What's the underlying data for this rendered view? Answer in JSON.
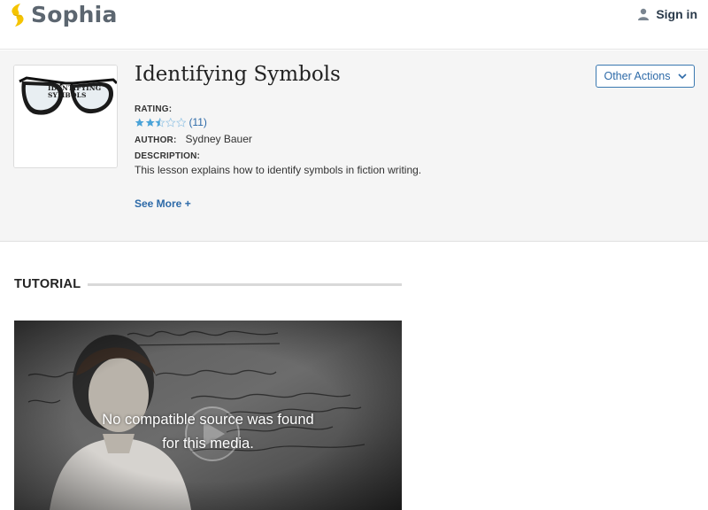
{
  "header": {
    "brand": "Sophia",
    "brand_icon": "sophia-leaf-logo",
    "sign_in_label": "Sign in",
    "sign_in_icon": "user-icon"
  },
  "lesson": {
    "thumbnail_caption": "IDENTIFYING SYMBOLS",
    "title": "Identifying Symbols",
    "other_actions_label": "Other Actions",
    "rating_label": "RATING:",
    "rating_stars": 2.5,
    "rating_max": 5,
    "rating_count": "(11)",
    "author_label": "AUTHOR:",
    "author_name": "Sydney Bauer",
    "description_label": "DESCRIPTION:",
    "description": "This lesson explains how to identify symbols in fiction writing.",
    "see_more": "See More +"
  },
  "tutorial": {
    "heading": "TUTORIAL",
    "video_error_line1": "No compatible source was found",
    "video_error_line2": "for this media."
  },
  "colors": {
    "accent": "#2d6aa8",
    "logo_yellow": "#f5c400",
    "star": "#4aa3d8"
  }
}
